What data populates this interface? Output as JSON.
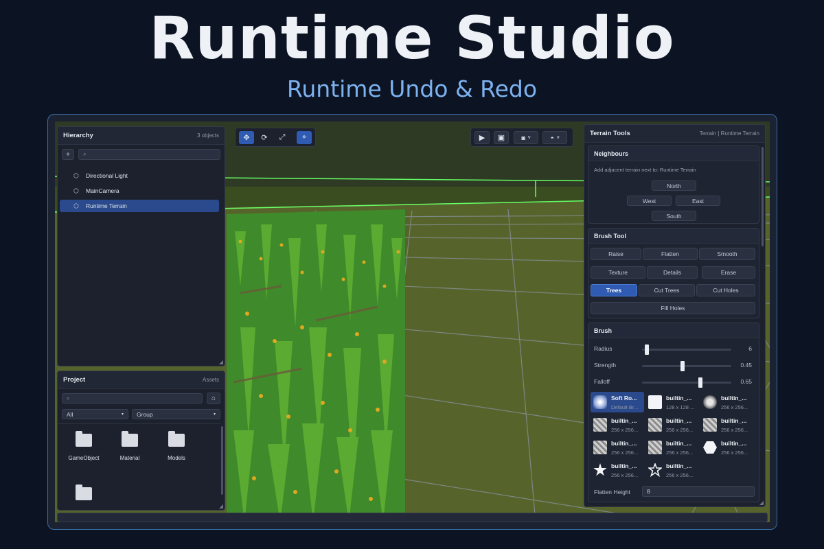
{
  "hero": {
    "title": "Runtime Studio",
    "subtitle": "Runtime Undo & Redo"
  },
  "colors": {
    "accent": "#2f5bb3",
    "frame_border": "#3b6ea8",
    "subtitle": "#7db2f0",
    "grass": "#4f8a2a"
  },
  "hierarchy": {
    "title": "Hierarchy",
    "count": "3 objects",
    "add_label": "+",
    "search_icon": "search-icon",
    "items": [
      {
        "label": "Directional Light",
        "icon": "cube-icon",
        "selected": false
      },
      {
        "label": "MainCamera",
        "icon": "cube-icon",
        "selected": false
      },
      {
        "label": "Runtime Terrain",
        "icon": "cube-icon",
        "selected": true
      }
    ]
  },
  "project": {
    "title": "Project",
    "tab": "Assets",
    "filter_type": "All",
    "filter_group": "Group",
    "folders": [
      "GameObject",
      "Material",
      "Models",
      ""
    ]
  },
  "toolbar": {
    "tools": [
      "move-icon",
      "rotate-icon",
      "scale-icon",
      "snap-icon"
    ],
    "right": [
      "play-icon",
      "lock-icon",
      "pivot-dropdown",
      "shading-dropdown"
    ],
    "dropdown_caret": "v"
  },
  "terrain_tools": {
    "title": "Terrain Tools",
    "breadcrumb": "Terrain | Runtime Terrain",
    "neighbours": {
      "title": "Neighbours",
      "hint": "Add adjacent terrain next to: Runtime Terrain",
      "north": "North",
      "west": "West",
      "east": "East",
      "south": "South"
    },
    "brush_tool": {
      "title": "Brush Tool",
      "buttons": [
        "Raise",
        "Flatten",
        "Smooth",
        "Texture",
        "Details",
        "Erase",
        "Trees",
        "Cut Trees",
        "Cut Holes",
        "Fill Holes"
      ],
      "active": "Trees"
    },
    "brush": {
      "title": "Brush",
      "sliders": [
        {
          "label": "Radius",
          "value": "6",
          "fraction": 0.05
        },
        {
          "label": "Strength",
          "value": "0.45",
          "fraction": 0.45
        },
        {
          "label": "Falloff",
          "value": "0.65",
          "fraction": 0.65
        }
      ],
      "items": [
        {
          "name": "Soft Ro...",
          "size": "Default Br...",
          "icon": "soft-round-brush-icon",
          "selected": true
        },
        {
          "name": "builtin_...",
          "size": "128 x 128 ...",
          "icon": "square-brush-icon"
        },
        {
          "name": "builtin_...",
          "size": "256 x 256...",
          "icon": "fuzzy-brush-icon"
        },
        {
          "name": "builtin_...",
          "size": "256 x 256...",
          "icon": "noise-brush-icon"
        },
        {
          "name": "builtin_...",
          "size": "256 x 256...",
          "icon": "noise-brush-icon"
        },
        {
          "name": "builtin_...",
          "size": "256 x 256...",
          "icon": "noise-brush-icon"
        },
        {
          "name": "builtin_...",
          "size": "256 x 256...",
          "icon": "noise-brush-icon"
        },
        {
          "name": "builtin_...",
          "size": "256 x 256...",
          "icon": "noise-brush-icon"
        },
        {
          "name": "builtin_...",
          "size": "256 x 256...",
          "icon": "hexagon-brush-icon"
        },
        {
          "name": "builtin_...",
          "size": "256 x 256...",
          "icon": "star-filled-brush-icon"
        },
        {
          "name": "builtin_...",
          "size": "256 x 256...",
          "icon": "star-outline-brush-icon"
        }
      ],
      "flatten_label": "Flatten Height",
      "flatten_value": "8"
    }
  }
}
